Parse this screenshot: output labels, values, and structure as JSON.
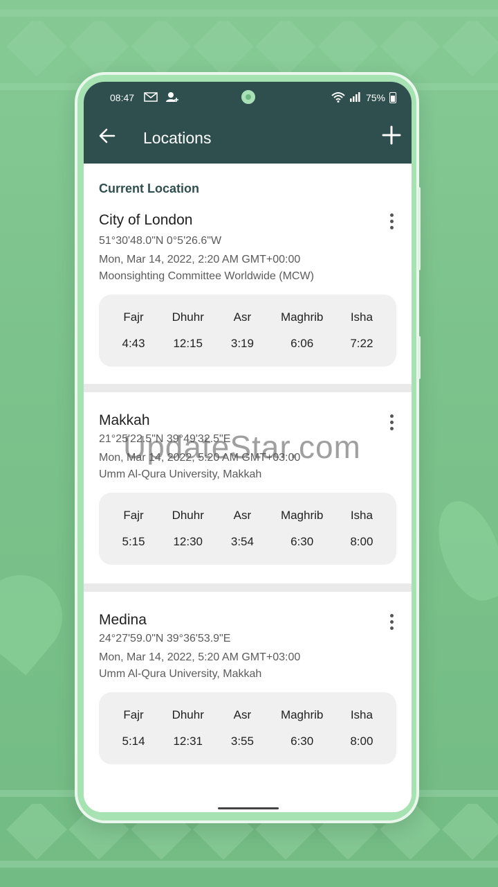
{
  "status_bar": {
    "time": "08:47",
    "battery": "75%"
  },
  "toolbar": {
    "title": "Locations"
  },
  "section_title": "Current Location",
  "locations": [
    {
      "name": "City of London",
      "coords": "51°30'48.0\"N  0°5'26.6\"W",
      "datetime": "Mon, Mar 14, 2022, 2:20 AM GMT+00:00",
      "method": "Moonsighting Committee Worldwide (MCW)",
      "prayers": [
        {
          "label": "Fajr",
          "time": "4:43"
        },
        {
          "label": "Dhuhr",
          "time": "12:15"
        },
        {
          "label": "Asr",
          "time": "3:19"
        },
        {
          "label": "Maghrib",
          "time": "6:06"
        },
        {
          "label": "Isha",
          "time": "7:22"
        }
      ]
    },
    {
      "name": "Makkah",
      "coords": "21°25'22.5\"N  39°49'32.5\"E",
      "datetime": "Mon, Mar 14, 2022, 5:20 AM GMT+03:00",
      "method": "Umm Al-Qura University, Makkah",
      "prayers": [
        {
          "label": "Fajr",
          "time": "5:15"
        },
        {
          "label": "Dhuhr",
          "time": "12:30"
        },
        {
          "label": "Asr",
          "time": "3:54"
        },
        {
          "label": "Maghrib",
          "time": "6:30"
        },
        {
          "label": "Isha",
          "time": "8:00"
        }
      ]
    },
    {
      "name": "Medina",
      "coords": "24°27'59.0\"N  39°36'53.9\"E",
      "datetime": "Mon, Mar 14, 2022, 5:20 AM GMT+03:00",
      "method": "Umm Al-Qura University, Makkah",
      "prayers": [
        {
          "label": "Fajr",
          "time": "5:14"
        },
        {
          "label": "Dhuhr",
          "time": "12:31"
        },
        {
          "label": "Asr",
          "time": "3:55"
        },
        {
          "label": "Maghrib",
          "time": "6:30"
        },
        {
          "label": "Isha",
          "time": "8:00"
        }
      ]
    }
  ],
  "watermark": "UpdateStar.com",
  "colors": {
    "appbar": "#2f4f4f",
    "background": "#7cc28c",
    "time_panel": "#f0f0f0"
  },
  "icons": {
    "back": "arrow-left-icon",
    "add": "plus-icon",
    "more": "kebab-menu-icon"
  }
}
